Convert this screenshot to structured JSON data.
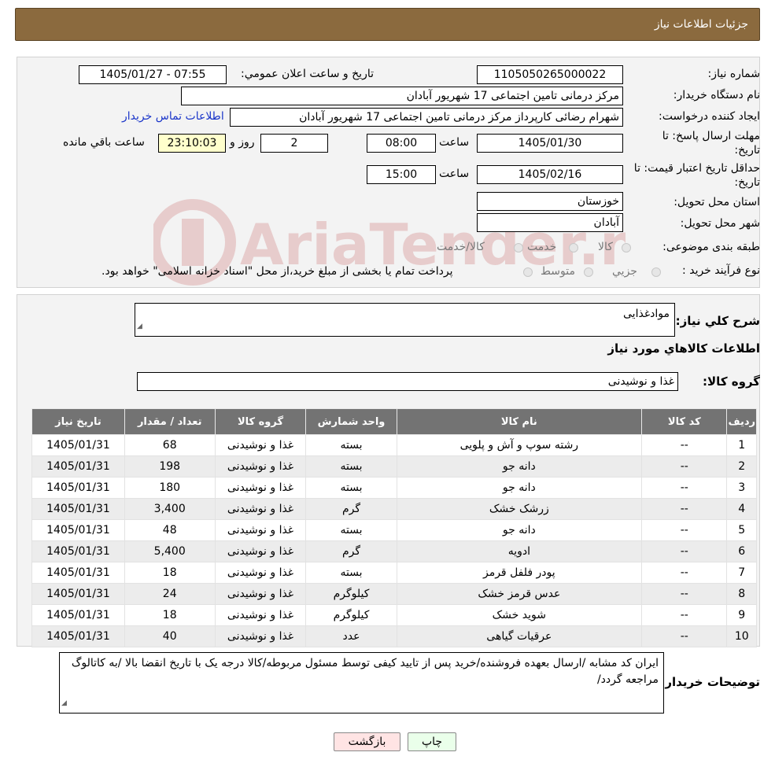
{
  "header": {
    "title": "جزئیات اطلاعات نیاز"
  },
  "form": {
    "need_number_label": "شماره نیاز:",
    "need_number": "1105050265000022",
    "announce_label": "تاریخ و ساعت اعلان عمومي:",
    "announce_value": "1405/01/27 - 07:55",
    "buyer_org_label": "نام دستگاه خريدار:",
    "buyer_org": "مرکز درمانی تامین اجتماعی 17 شهریور آبادان",
    "creator_label": "ايجاد کننده درخواست:",
    "creator": "شهرام رضائی کارپرداز مرکز درمانی تامین اجتماعی 17 شهریور آبادان",
    "contact_link": "اطلاعات تماس خريدار",
    "deadline_label_1": "مهلت ارسال پاسخ: تا",
    "deadline_label_2": "تاریخ:",
    "deadline_date": "1405/01/30",
    "time_label": "ساعت",
    "deadline_time": "08:00",
    "days_value": "2",
    "days_label": "روز و",
    "remaining_time": "23:10:03",
    "remaining_label": "ساعت باقي مانده",
    "validity_label_1": "حداقل تاريخ اعتبار قيمت: تا",
    "validity_label_2": "تاريخ:",
    "validity_date": "1405/02/16",
    "validity_time": "15:00",
    "province_label": "استان محل تحويل:",
    "province": "خوزستان",
    "city_label": "شهر محل تحويل:",
    "city": "آبادان",
    "category_label": "طبقه بندی موضوعی:",
    "category_options": [
      "کالا",
      "خدمت",
      "کالا/خدمت"
    ],
    "process_label": "نوع فرآيند خريد :",
    "process_options": [
      "جزيي",
      "متوسط"
    ],
    "process_note": "پرداخت تمام يا بخشی از مبلغ خريد،از محل \"اسناد خزانه اسلامی\" خواهد بود."
  },
  "details": {
    "summary_label": "شرح کلي نياز:",
    "summary": "موادغذایی",
    "goods_title": "اطلاعات کالاهاي مورد نياز",
    "group_label": "گروه کالا:",
    "group": "غذا و نوشیدنی",
    "notes_label": "توضيحات خريدار:",
    "notes": "ایران کد مشابه /ارسال بعهده فروشنده/خرید پس از تایید کیفی توسط مسئول مربوطه/کالا درجه یک با تاریخ انقضا بالا /به کاتالوگ مراجعه گردد/"
  },
  "table": {
    "headers": [
      "رديف",
      "کد کالا",
      "نام کالا",
      "واحد شمارش",
      "گروه کالا",
      "تعداد / مقدار",
      "تاريخ نياز"
    ],
    "rows": [
      [
        "1",
        "--",
        "رشته سوپ و آش و پلویی",
        "بسته",
        "غذا و نوشیدنی",
        "68",
        "1405/01/31"
      ],
      [
        "2",
        "--",
        "دانه جو",
        "بسته",
        "غذا و نوشیدنی",
        "198",
        "1405/01/31"
      ],
      [
        "3",
        "--",
        "دانه جو",
        "بسته",
        "غذا و نوشیدنی",
        "180",
        "1405/01/31"
      ],
      [
        "4",
        "--",
        "زرشک خشک",
        "گرم",
        "غذا و نوشیدنی",
        "3,400",
        "1405/01/31"
      ],
      [
        "5",
        "--",
        "دانه جو",
        "بسته",
        "غذا و نوشیدنی",
        "48",
        "1405/01/31"
      ],
      [
        "6",
        "--",
        "ادويه",
        "گرم",
        "غذا و نوشیدنی",
        "5,400",
        "1405/01/31"
      ],
      [
        "7",
        "--",
        "پودر فلفل قرمز",
        "بسته",
        "غذا و نوشیدنی",
        "18",
        "1405/01/31"
      ],
      [
        "8",
        "--",
        "عدس قرمز خشک",
        "کیلوگرم",
        "غذا و نوشیدنی",
        "24",
        "1405/01/31"
      ],
      [
        "9",
        "--",
        "شوید خشک",
        "کیلوگرم",
        "غذا و نوشیدنی",
        "18",
        "1405/01/31"
      ],
      [
        "10",
        "--",
        "عرقیات گیاهی",
        "عدد",
        "غذا و نوشیدنی",
        "40",
        "1405/01/31"
      ]
    ]
  },
  "buttons": {
    "print": "چاپ",
    "back": "بازگشت"
  },
  "watermark": {
    "text": "AriaTender.neT"
  },
  "colors": {
    "header_bg": "#8b6a3e",
    "table_header_bg": "#737373",
    "link": "#1a35c9",
    "back_button_bg": "#ffe4e4",
    "print_button_bg": "#eaffea"
  }
}
